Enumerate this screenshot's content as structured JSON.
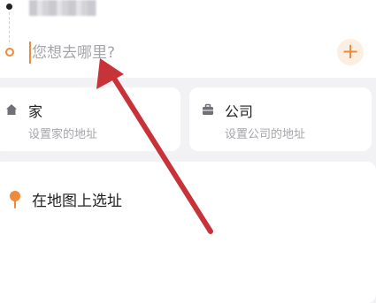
{
  "route": {
    "destination_placeholder": "您想去哪里?",
    "add_label": "+"
  },
  "shortcuts": {
    "home": {
      "title": "家",
      "subtitle": "设置家的地址",
      "icon": "home-icon"
    },
    "company": {
      "title": "公司",
      "subtitle": "设置公司的地址",
      "icon": "briefcase-icon"
    }
  },
  "map_pick": {
    "label": "在地图上选址",
    "icon": "map-pin-icon"
  },
  "colors": {
    "accent": "#ee8a3c",
    "annotation_arrow": "#c8333a"
  }
}
